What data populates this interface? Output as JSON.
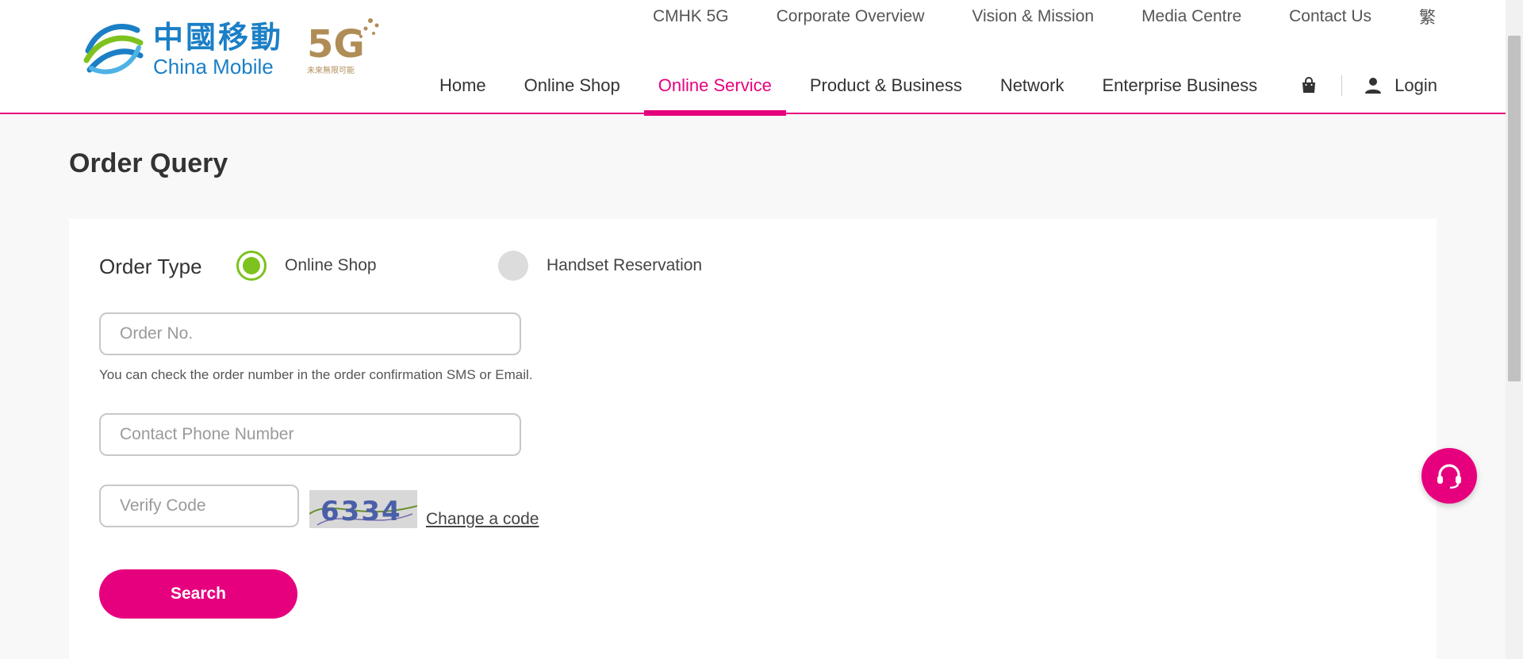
{
  "brand": {
    "name_cn": "中國移動",
    "name_en": "China Mobile",
    "badge": "5G",
    "badge_tagline": "未來無限可能"
  },
  "top_links": [
    "CMHK 5G",
    "Corporate Overview",
    "Vision & Mission",
    "Media Centre",
    "Contact Us",
    "繁"
  ],
  "main_nav": {
    "items": [
      "Home",
      "Online Shop",
      "Online Service",
      "Product & Business",
      "Network",
      "Enterprise Business"
    ],
    "active": "Online Service",
    "login": "Login"
  },
  "page": {
    "title": "Order Query"
  },
  "form": {
    "order_type_label": "Order Type",
    "options": [
      {
        "label": "Online Shop",
        "checked": true
      },
      {
        "label": "Handset Reservation",
        "checked": false
      }
    ],
    "order_no_placeholder": "Order No.",
    "order_no_hint": "You can check the order number in the order confirmation SMS or Email.",
    "phone_placeholder": "Contact Phone Number",
    "verify_placeholder": "Verify Code",
    "captcha_text": "6334",
    "change_code": "Change a code",
    "search": "Search"
  },
  "colors": {
    "brand_pink": "#e6007e",
    "radio_green": "#7dc21e",
    "logo_blue": "#1b7fc6",
    "gold": "#b08d57"
  },
  "icons": {
    "cart": "shopping-bag-icon",
    "user": "user-icon",
    "chat": "headset-icon"
  }
}
